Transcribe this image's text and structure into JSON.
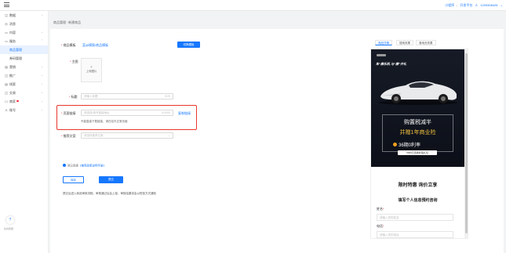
{
  "header": {
    "links": [
      "小程序",
      "开发平台"
    ],
    "account": "120930842​6"
  },
  "sidebar": {
    "items": [
      {
        "icon": "◫",
        "label": "数据",
        "chevron": true
      },
      {
        "icon": "◎",
        "label": "消息",
        "chevron": false
      },
      {
        "icon": "▭",
        "label": "内容",
        "chevron": true
      },
      {
        "icon": "▭",
        "label": "服务",
        "chevron": true
      },
      {
        "icon": "",
        "label": "商品管理",
        "sub": true,
        "active": true
      },
      {
        "icon": "",
        "label": "券码管理",
        "sub": true
      },
      {
        "icon": "▤",
        "label": "营销",
        "chevron": true
      },
      {
        "icon": "◫",
        "label": "推广",
        "chevron": true
      },
      {
        "icon": "▤",
        "label": "线索",
        "chevron": true
      },
      {
        "icon": "◫",
        "label": "交易",
        "chevron": true
      },
      {
        "icon": "☐",
        "label": "商家",
        "chevron": true,
        "dot": true
      },
      {
        "icon": "♙",
        "label": "账号",
        "chevron": true
      }
    ],
    "help_icon": "?",
    "help_label": "在线客服"
  },
  "breadcrumb": [
    "商品管理",
    "新建商品"
  ],
  "form": {
    "template_label": "商品模板",
    "template_value": "蓝@模版/商品模板",
    "template_button": "切换模板",
    "main_image_label": "主图",
    "upload_plus": "+",
    "upload_text": "上传图片",
    "title_label": "标题",
    "title_placeholder": "请输入标题",
    "title_count": "0/20",
    "page_link_label": "页面链接",
    "page_link_placeholder": "请选择/填写链接地址",
    "page_link_count": "0/1000",
    "page_link_button": "复制链接",
    "page_link_hint": "不能直接下载链接，请在站外正常页面",
    "copy_label": "推荐文案",
    "copy_placeholder": "请选择推荐文案",
    "agree_prefix": "我已阅读",
    "agree_doc": "《推荐政策说明手册》",
    "save_button": "保存",
    "submit_button": "提交",
    "footnote": "提交后进入商品审核流程，审核通过后会上架，审核结果将会以短信方式通知"
  },
  "preview": {
    "tabs": [
      "商品详情",
      "搜索效果",
      "落地页效果"
    ],
    "ad_tagline": "车“康乐机 与“康”开礼",
    "ad_headline": "购置税减半",
    "ad_offer": "并赠1年商业险",
    "ad_rate": "36期0利率",
    "ad_cta": "5000元置换补贴礼包",
    "form_title": "限时特惠 询价立享",
    "form_subtitle": "填写个人信息预约咨询",
    "name_label": "姓名",
    "name_placeholder": "请输入您的姓名",
    "phone_label": "电话",
    "phone_placeholder": "请输入您的电话"
  },
  "colors": {
    "accent": "#1677ff",
    "highlight": "#e8372c",
    "ad_gold": "#f0c040"
  }
}
